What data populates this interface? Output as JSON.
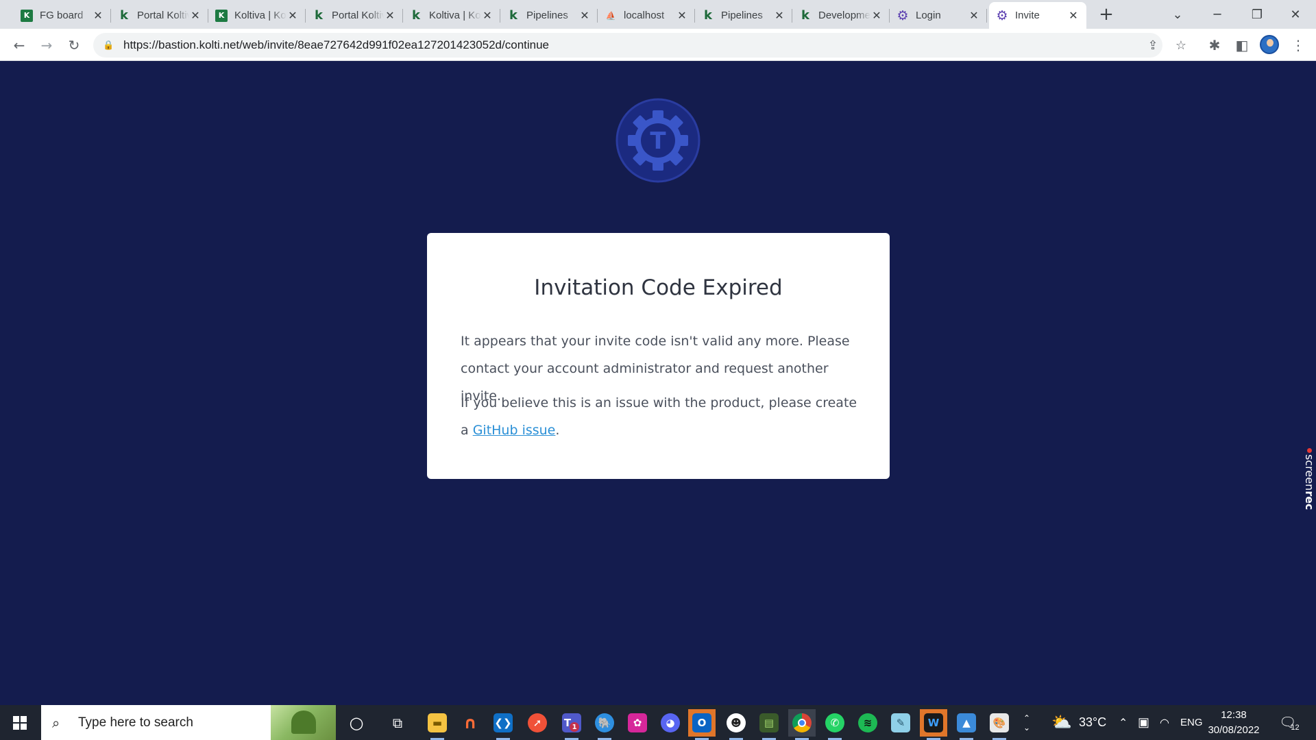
{
  "browser": {
    "tabs": [
      {
        "title": "FG board",
        "icon": "koltiva-x-icon"
      },
      {
        "title": "Portal Koltiva",
        "icon": "koltiva-k-icon"
      },
      {
        "title": "Koltiva | Koltiva",
        "icon": "koltiva-x-icon"
      },
      {
        "title": "Portal Koltiva",
        "icon": "koltiva-k-icon"
      },
      {
        "title": "Koltiva | Koltiva",
        "icon": "koltiva-k-icon"
      },
      {
        "title": "Pipelines",
        "icon": "koltiva-k-icon"
      },
      {
        "title": "localhost",
        "icon": "phpmyadmin-icon"
      },
      {
        "title": "Pipelines",
        "icon": "koltiva-k-icon"
      },
      {
        "title": "Development",
        "icon": "koltiva-k-icon"
      },
      {
        "title": "Login",
        "icon": "teleport-gear-icon"
      },
      {
        "title": "Invite",
        "icon": "teleport-gear-icon",
        "active": true
      }
    ],
    "new_tab_symbol": "+",
    "url": "https://bastion.kolti.net/web/invite/8eae727642d991f02ea127201423052d/continue"
  },
  "page": {
    "title": "Invitation Code Expired",
    "paragraph1": "It appears that your invite code isn't valid any more. Please contact your account administrator and request another invite.",
    "paragraph2_prefix": "If you believe this is an issue with the product, please create a ",
    "paragraph2_link": "GitHub issue",
    "paragraph2_suffix": ".",
    "logo_letter": "T",
    "screenrec_label_light": "screen",
    "screenrec_label_bold": "rec"
  },
  "taskbar": {
    "search_placeholder": "Type here to search",
    "apps": [
      "cortana-icon",
      "task-view-icon",
      "file-explorer-icon",
      "postman-icon",
      "vscode-icon",
      "swift-icon",
      "teams-icon",
      "tableplus-icon",
      "studio3t-icon",
      "discord-icon",
      "outlook-icon",
      "app-icon",
      "terminal-icon",
      "chrome-icon",
      "whatsapp-icon",
      "spotify-icon",
      "notes-icon",
      "winamp-icon",
      "photos-icon",
      "paint-icon"
    ],
    "teams_badge": "1",
    "weather": "33°C",
    "language": "ENG",
    "time": "12:38",
    "date": "30/08/2022",
    "notification_count": "12"
  },
  "colors": {
    "page_bg": "#141c4e",
    "card_bg": "#ffffff",
    "link": "#2a8fd6",
    "logo_fill": "#3a56c8",
    "logo_ring": "#1b2a80"
  }
}
